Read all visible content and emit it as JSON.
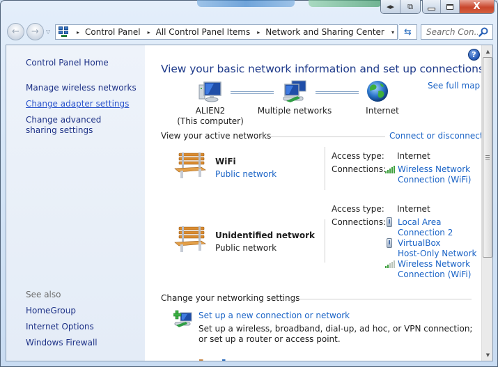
{
  "window": {
    "caption_buttons": {
      "snap": "◂▸",
      "switch": "⧉",
      "minimize": "minimize",
      "maximize": "maximize",
      "close": "X"
    }
  },
  "navigation": {
    "back_glyph": "←",
    "forward_glyph": "→",
    "recent_glyph": "▽",
    "breadcrumb": [
      "Control Panel",
      "All Control Panel Items",
      "Network and Sharing Center"
    ],
    "separator_glyph": "▸",
    "dropdown_glyph": "▾",
    "refresh_glyph": "⇆",
    "search_placeholder": "Search Con..."
  },
  "sidebar": {
    "home": "Control Panel Home",
    "tasks": [
      {
        "label": "Manage wireless networks",
        "active": false
      },
      {
        "label": "Change adapter settings",
        "active": true
      },
      {
        "label": "Change advanced sharing settings",
        "active": false
      }
    ],
    "see_also_heading": "See also",
    "see_also": [
      "HomeGroup",
      "Internet Options",
      "Windows Firewall"
    ]
  },
  "main": {
    "help_glyph": "?",
    "title": "View your basic network information and set up connections",
    "see_full_map": "See full map",
    "network_map": [
      {
        "icon": "computer-icon",
        "label": "ALIEN2",
        "sublabel": "(This computer)"
      },
      {
        "icon": "multiple-networks-icon",
        "label": "Multiple networks",
        "sublabel": ""
      },
      {
        "icon": "globe-icon",
        "label": "Internet",
        "sublabel": ""
      }
    ],
    "active_networks": {
      "heading": "View your active networks",
      "connect_link": "Connect or disconnect",
      "access_type_label": "Access type:",
      "connections_label": "Connections:",
      "networks": [
        {
          "name": "WiFi",
          "category": "Public network",
          "access_type": "Internet",
          "connections": [
            {
              "icon": "wifi-signal-icon",
              "lines": [
                "Wireless Network",
                "Connection (WiFi)"
              ]
            }
          ]
        },
        {
          "name": "Unidentified network",
          "category": "Public network",
          "access_type": "Internet",
          "connections": [
            {
              "icon": "ethernet-icon",
              "lines": [
                "Local Area",
                "Connection 2"
              ]
            },
            {
              "icon": "ethernet-icon",
              "lines": [
                "VirtualBox",
                "Host-Only Network"
              ]
            },
            {
              "icon": "wifi-signal-icon",
              "lines": [
                "Wireless Network",
                "Connection (WiFi)"
              ]
            }
          ]
        }
      ]
    },
    "change_settings": {
      "heading": "Change your networking settings",
      "tasks": [
        {
          "label": "Set up a new connection or network",
          "description": "Set up a wireless, broadband, dial-up, ad hoc, or VPN connection; or set up a router or access point."
        }
      ]
    }
  },
  "colors": {
    "link": "#1a63c6",
    "sidebar_link": "#1e3287",
    "title": "#1e3a8a",
    "close_button": "#c9462c"
  }
}
